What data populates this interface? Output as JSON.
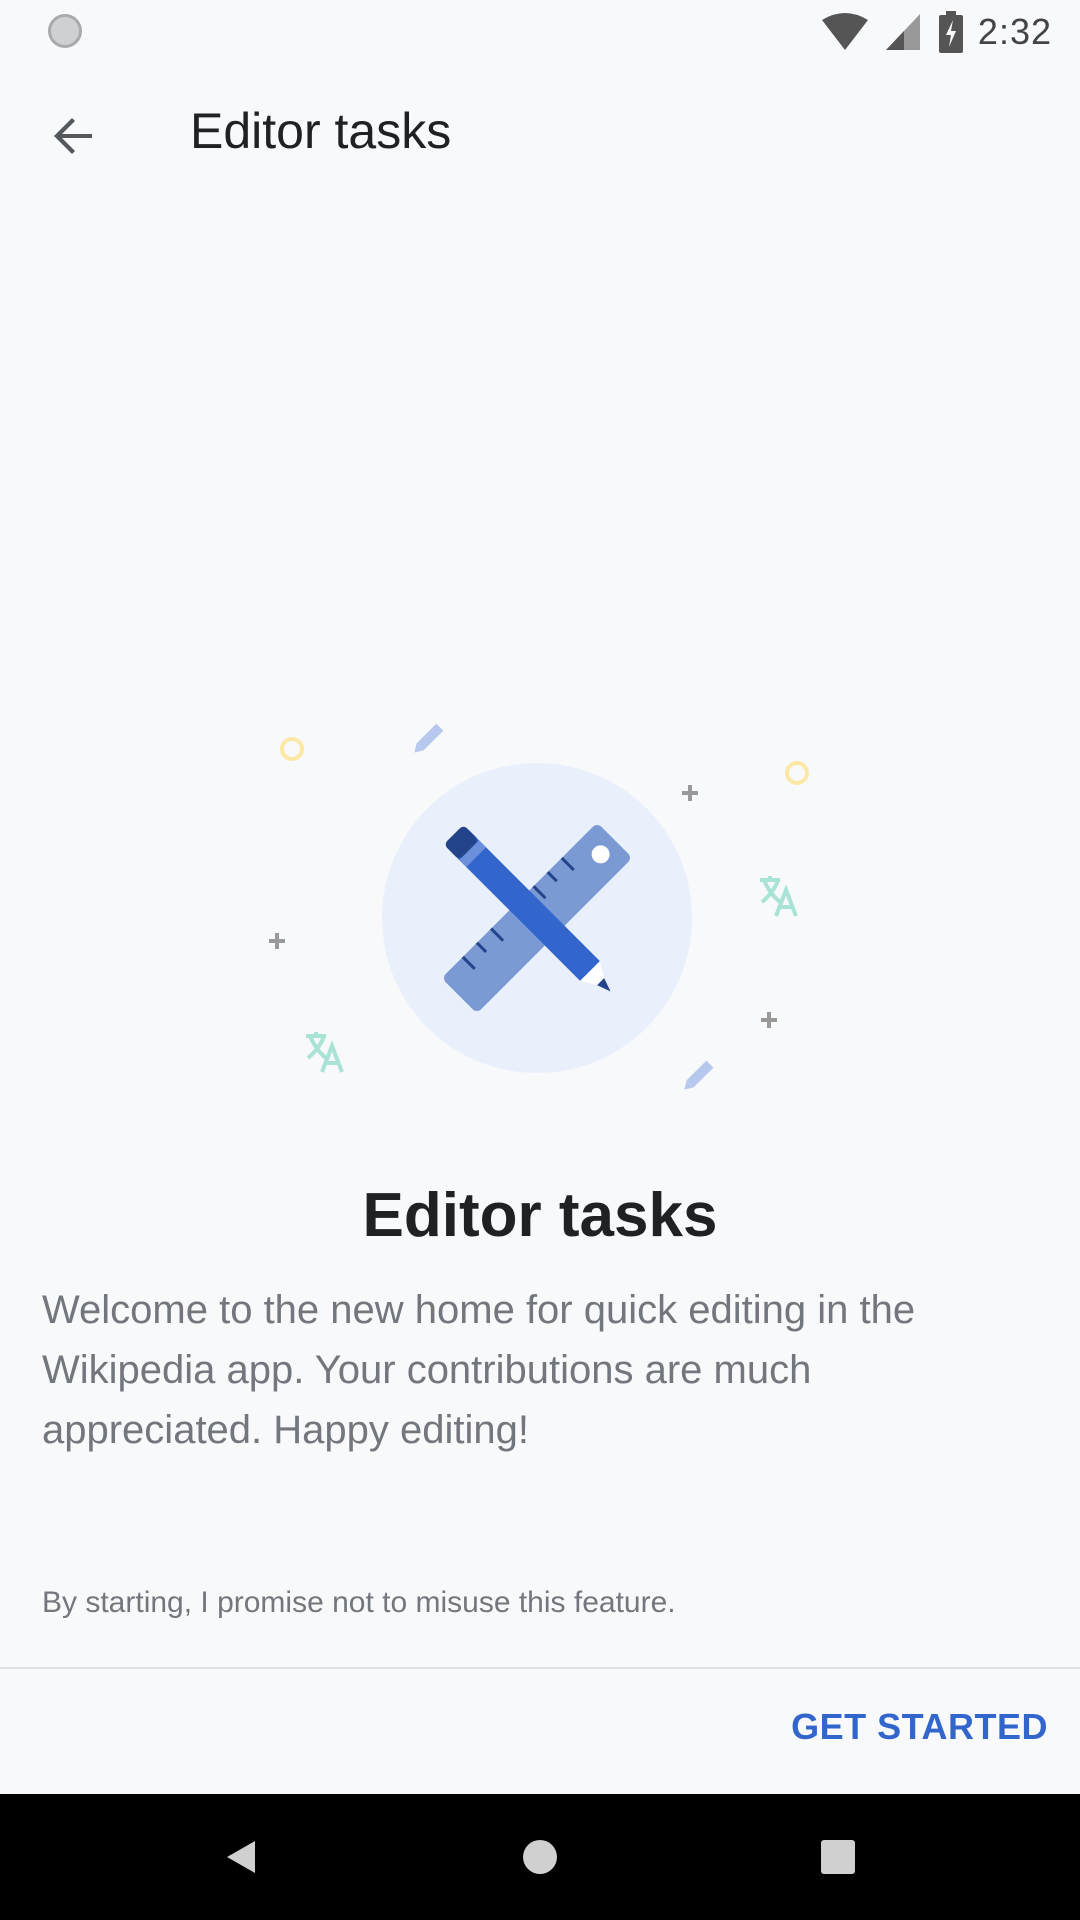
{
  "status_bar": {
    "time": "2:32",
    "icons": [
      "loading-circle-icon",
      "wifi-icon",
      "signal-icon",
      "battery-charging-icon"
    ]
  },
  "toolbar": {
    "title": "Editor tasks",
    "back_icon": "arrow-back-icon"
  },
  "onboarding": {
    "heading": "Editor tasks",
    "description": "Welcome to the new home for quick editing in the Wikipedia app. Your contributions are much appreciated. Happy editing!",
    "disclaimer": "By starting, I promise not to misuse this feature.",
    "illustration_icon": "ruler-pencil-icon"
  },
  "actions": {
    "get_started_label": "GET STARTED"
  },
  "nav_bar": {
    "back_icon": "triangle-back-icon",
    "home_icon": "circle-home-icon",
    "recents_icon": "square-recents-icon"
  },
  "colors": {
    "accent": "#3366cc",
    "background": "#f8f9fb",
    "text_primary": "#202122",
    "text_secondary": "#72777d"
  }
}
